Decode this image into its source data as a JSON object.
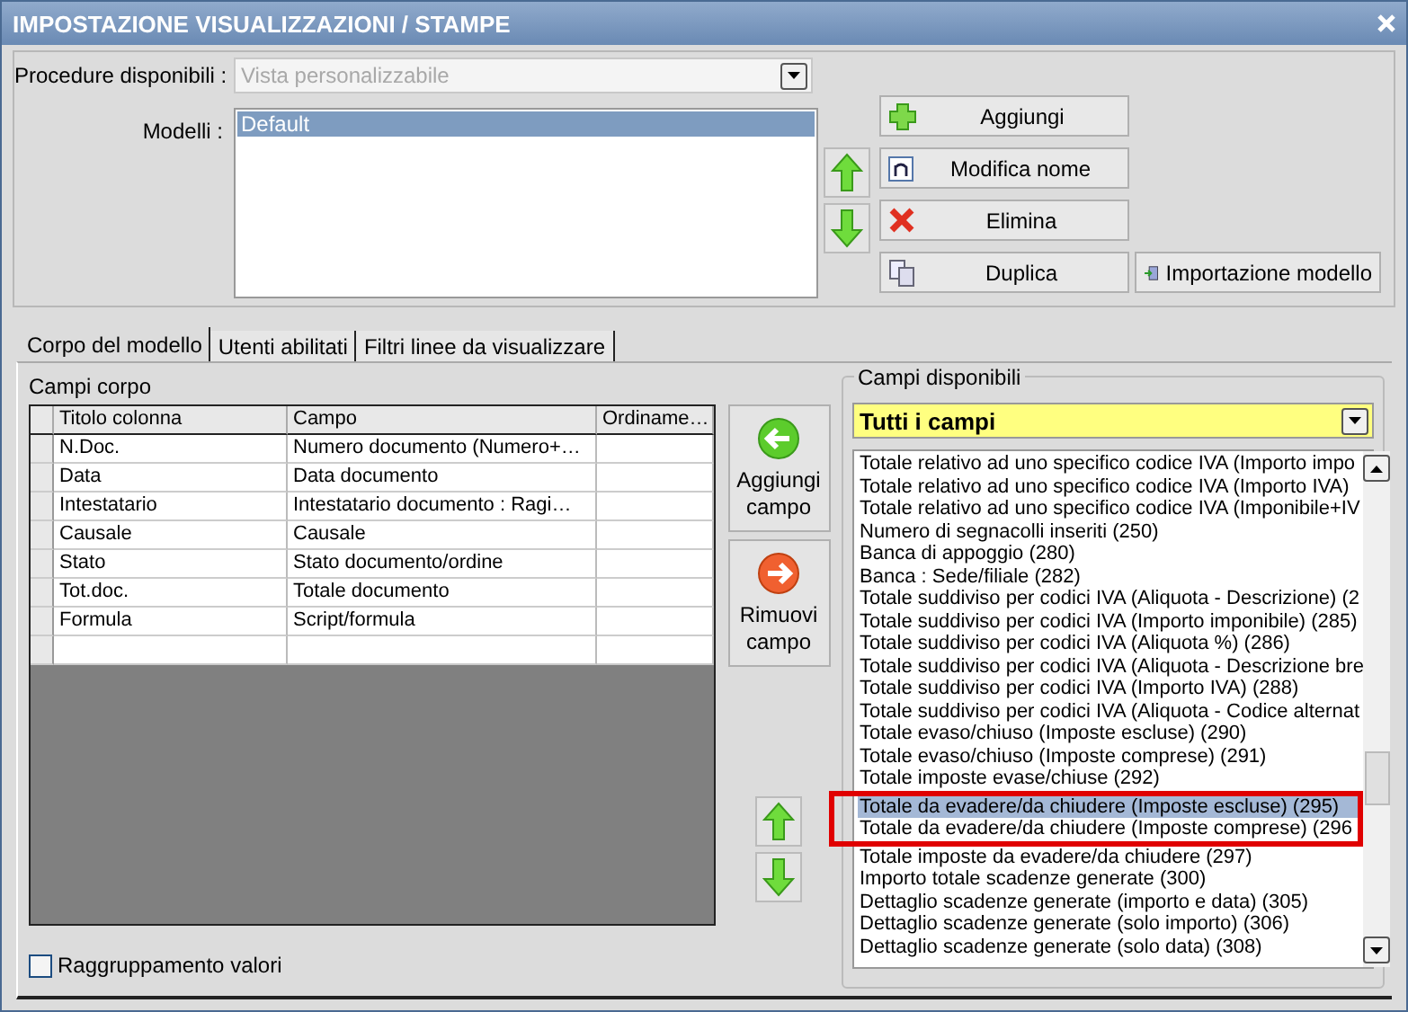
{
  "window": {
    "title": "IMPOSTAZIONE VISUALIZZAZIONI / STAMPE"
  },
  "procedure": {
    "label": "Procedure disponibili :",
    "placeholder": "Vista personalizzabile"
  },
  "models": {
    "label": "Modelli :",
    "items": [
      {
        "text": "Default",
        "selected": true
      }
    ]
  },
  "model_buttons": [
    "Aggiungi",
    "Modifica nome",
    "Elimina",
    "Duplica",
    "Importazione modello"
  ],
  "tabs": [
    {
      "label": "Corpo del modello",
      "selected": true
    },
    {
      "label": "Utenti abilitati",
      "selected": false
    },
    {
      "label": "Filtri linee da visualizzare",
      "selected": false
    }
  ],
  "body_fields": {
    "label": "Campi corpo",
    "columns": [
      "Titolo colonna",
      "Campo",
      "Ordiname…"
    ],
    "rows": [
      [
        "N.Doc.",
        "Numero documento (Numero+…",
        ""
      ],
      [
        "Data",
        "Data documento",
        ""
      ],
      [
        "Intestatario",
        "Intestatario documento : Ragi…",
        ""
      ],
      [
        "Causale",
        "Causale",
        ""
      ],
      [
        "Stato",
        "Stato documento/ordine",
        ""
      ],
      [
        "Tot.doc.",
        "Totale documento",
        ""
      ],
      [
        "Formula",
        "Script/formula",
        ""
      ],
      [
        "",
        "",
        ""
      ]
    ]
  },
  "field_buttons": [
    "Aggiungi campo",
    "Rimuovi campo"
  ],
  "available": {
    "label": "Campi disponibili",
    "filter": "Tutti i campi",
    "items": [
      {
        "text": "Totale relativo ad uno specifico codice IVA (Importo impo",
        "selected": false
      },
      {
        "text": "Totale relativo ad uno specifico codice IVA (Importo IVA)",
        "selected": false
      },
      {
        "text": "Totale relativo ad uno specifico codice IVA (Imponibile+IV",
        "selected": false
      },
      {
        "text": "Numero di segnacolli inseriti (250)",
        "selected": false
      },
      {
        "text": "Banca di appoggio (280)",
        "selected": false
      },
      {
        "text": "Banca : Sede/filiale (282)",
        "selected": false
      },
      {
        "text": "Totale suddiviso per codici IVA (Aliquota - Descrizione) (2",
        "selected": false
      },
      {
        "text": "Totale suddiviso per codici IVA (Importo imponibile) (285)",
        "selected": false
      },
      {
        "text": "Totale suddiviso per codici IVA (Aliquota %) (286)",
        "selected": false
      },
      {
        "text": "Totale suddiviso per codici IVA (Aliquota - Descrizione bre",
        "selected": false
      },
      {
        "text": "Totale suddiviso per codici IVA (Importo IVA) (288)",
        "selected": false
      },
      {
        "text": "Totale suddiviso per codici IVA (Aliquota - Codice alternat",
        "selected": false
      },
      {
        "text": "Totale evaso/chiuso (Imposte escluse) (290)",
        "selected": false
      },
      {
        "text": "Totale evaso/chiuso (Imposte comprese) (291)",
        "selected": false
      },
      {
        "text": "Totale imposte evase/chiuse (292)",
        "selected": false
      },
      {
        "text": "Totale da evadere/da chiudere (Imposte escluse) (295)",
        "selected": true
      },
      {
        "text": "Totale da evadere/da chiudere (Imposte comprese) (296",
        "selected": false
      },
      {
        "text": "Totale imposte da evadere/da chiudere (297)",
        "selected": false
      },
      {
        "text": "Importo totale scadenze generate (300)",
        "selected": false
      },
      {
        "text": "Dettaglio scadenze generate (importo e data) (305)",
        "selected": false
      },
      {
        "text": "Dettaglio scadenze generate (solo importo) (306)",
        "selected": false
      },
      {
        "text": "Dettaglio scadenze generate (solo data) (308)",
        "selected": false
      }
    ]
  },
  "grouping": {
    "label": "Raggruppamento valori",
    "checked": false
  }
}
